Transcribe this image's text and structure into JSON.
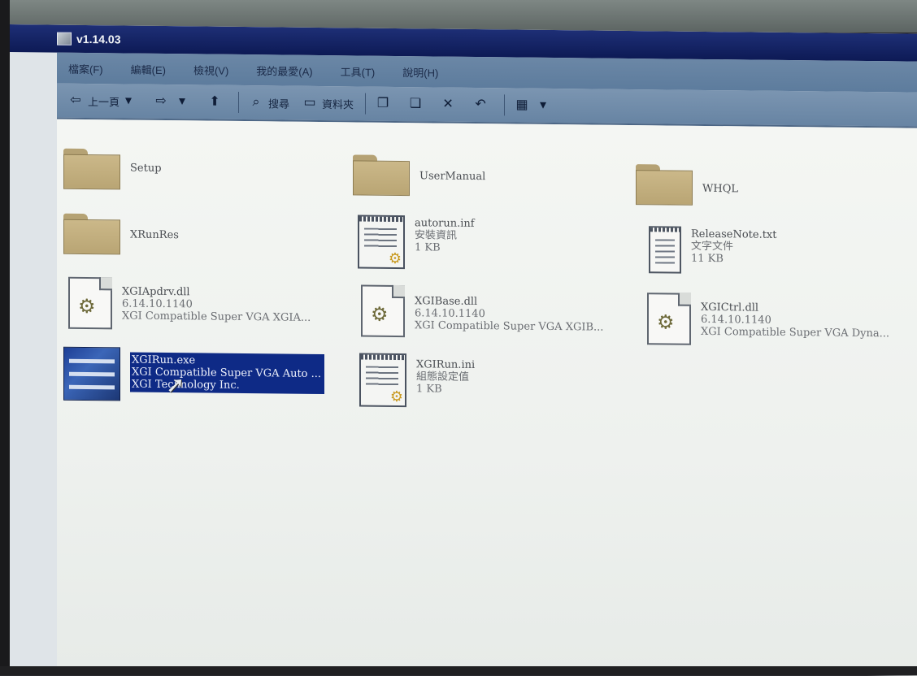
{
  "window": {
    "title": "v1.14.03"
  },
  "menu": [
    "檔案(F)",
    "編輯(E)",
    "檢視(V)",
    "我的最愛(A)",
    "工具(T)",
    "說明(H)"
  ],
  "toolbar": {
    "back": "上一頁",
    "search": "搜尋",
    "folders": "資料夾"
  },
  "items": [
    {
      "name": "Setup"
    },
    {
      "name": "UserManual"
    },
    {
      "name": "WHQL"
    },
    {
      "name": "XRunRes"
    },
    {
      "name": "autorun.inf",
      "line2": "安裝資訊",
      "line3": "1 KB"
    },
    {
      "name": "ReleaseNote.txt",
      "line2": "文字文件",
      "line3": "11 KB"
    },
    {
      "name": "XGIApdrv.dll",
      "line2": "6.14.10.1140",
      "line3": "XGI Compatible Super VGA XGIA..."
    },
    {
      "name": "XGIBase.dll",
      "line2": "6.14.10.1140",
      "line3": "XGI Compatible Super VGA XGIB..."
    },
    {
      "name": "XGICtrl.dll",
      "line2": "6.14.10.1140",
      "line3": "XGI Compatible Super VGA Dyna..."
    },
    {
      "name": "XGIRun.exe",
      "line2": "XGI Compatible Super VGA Auto ...",
      "line3": "XGI Technology Inc."
    },
    {
      "name": "XGIRun.ini",
      "line2": "組態設定值",
      "line3": "1 KB"
    }
  ]
}
